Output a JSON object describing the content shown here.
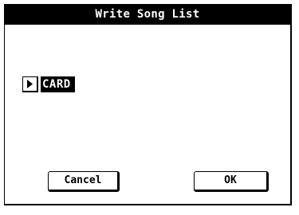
{
  "dialog": {
    "title": "Write Song List",
    "device": {
      "icon": "triangle-right-icon",
      "label": "CARD"
    },
    "buttons": {
      "cancel": "Cancel",
      "ok": "OK"
    }
  }
}
